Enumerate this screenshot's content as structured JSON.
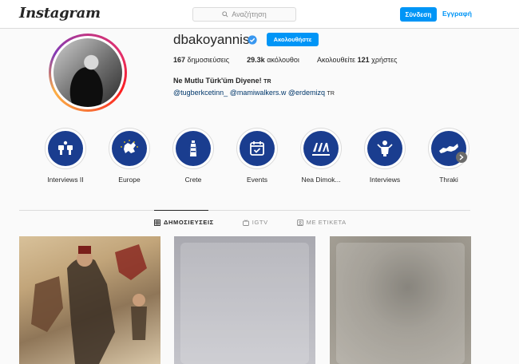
{
  "header": {
    "logo": "Instagram",
    "search_placeholder": "Αναζήτηση",
    "login_label": "Σύνδεση",
    "signup_label": "Εγγραφή"
  },
  "profile": {
    "username": "dbakoyannis",
    "follow_label": "Ακολουθήστε",
    "stats": {
      "posts_count": "167",
      "posts_label": "δημοσιεύσεις",
      "followers_count": "29.3k",
      "followers_label": "ακόλουθοι",
      "following_prefix": "Ακολουθείτε",
      "following_count": "121",
      "following_suffix": "χρήστες"
    },
    "bio_name": "Ne Mutlu Türk'üm Diyene!",
    "bio_name_badge": "TR",
    "tags": [
      "@tugberkcetinn_",
      "@mamiwalkers.w",
      "@erdemizq"
    ],
    "tags_badge": "TR"
  },
  "highlights": [
    {
      "label": "Interviews II",
      "icon": "microphones-icon"
    },
    {
      "label": "Europe",
      "icon": "eu-map-icon"
    },
    {
      "label": "Crete",
      "icon": "lighthouse-icon"
    },
    {
      "label": "Events",
      "icon": "calendar-icon"
    },
    {
      "label": "Nea Dimok...",
      "icon": "nd-logo-icon"
    },
    {
      "label": "Interviews",
      "icon": "speaker-icon"
    },
    {
      "label": "Thraki",
      "icon": "thraki-map-icon"
    }
  ],
  "tabs": [
    {
      "label": "ΔΗΜΟΣΙΕΥΣΕΙΣ",
      "icon": "grid-icon",
      "active": true
    },
    {
      "label": "IGTV",
      "icon": "igtv-icon",
      "active": false
    },
    {
      "label": "ΜΕ ΕΤΙΚΕΤΑ",
      "icon": "tag-icon",
      "active": false
    }
  ],
  "colors": {
    "accent": "#0095f6",
    "highlight_bg": "#1a3d8f",
    "text": "#262626",
    "border": "#dbdbdb"
  }
}
